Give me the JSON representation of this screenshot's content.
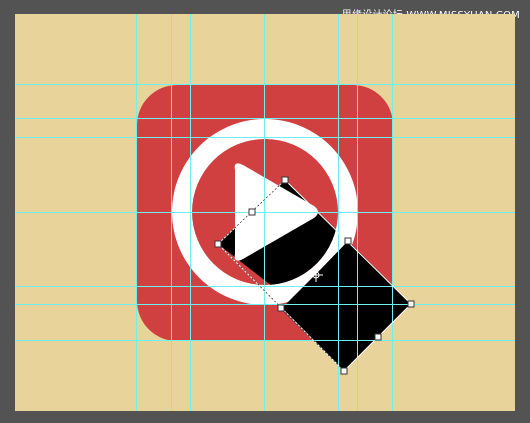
{
  "watermark": {
    "text": "思缘设计论坛 WWW.MISSYUAN.COM"
  },
  "colors": {
    "workspace": "#535353",
    "document_background": "#e8d49b",
    "icon_red": "#d04040",
    "icon_white": "#ffffff",
    "shadow_shape": "#000000",
    "guides": "#6ef0f0",
    "selection_outline": "#ffffff",
    "handle_fill": "#ffffff",
    "handle_stroke": "#333333"
  },
  "icons": {
    "play": "play-icon",
    "transform_center": "crosshair-icon"
  }
}
